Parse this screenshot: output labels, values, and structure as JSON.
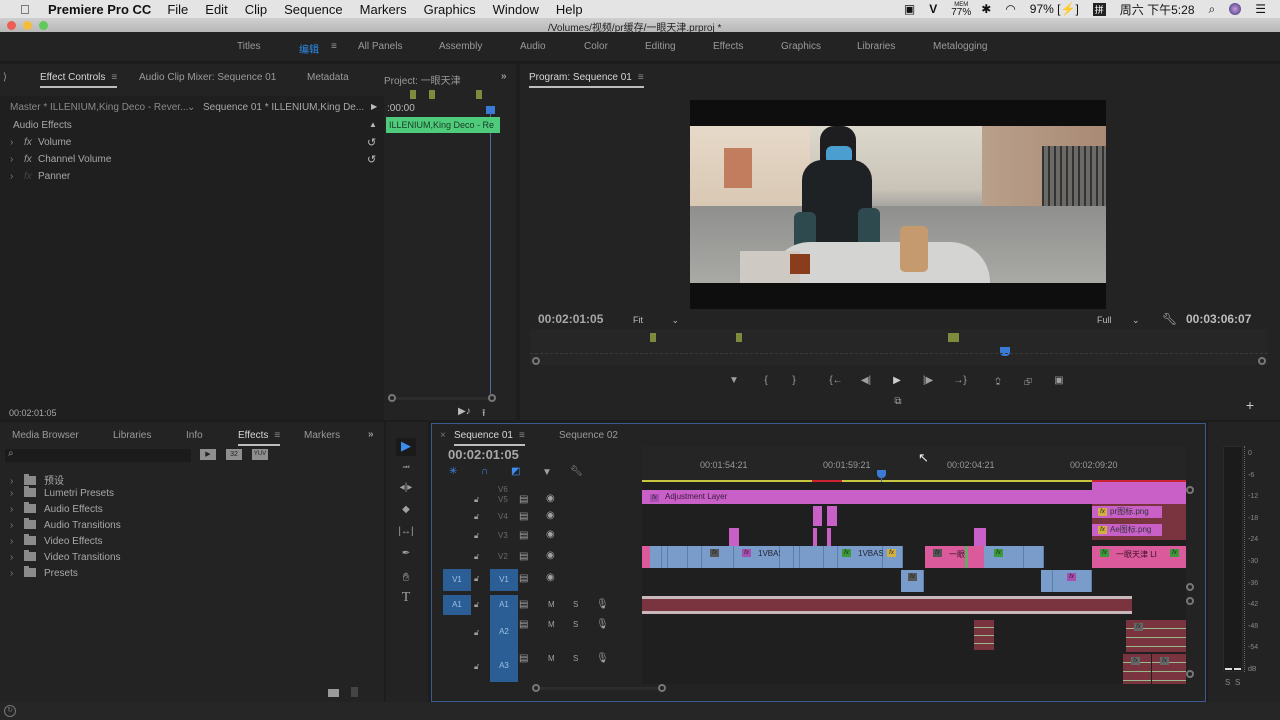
{
  "menubar": {
    "app_name": "Premiere Pro CC",
    "items": [
      "File",
      "Edit",
      "Clip",
      "Sequence",
      "Markers",
      "Graphics",
      "Window",
      "Help"
    ],
    "status": {
      "mem_label": "MEM",
      "mem_value": "77%",
      "battery": "97%",
      "clock": "周六 下午5:28"
    }
  },
  "window": {
    "title": "/Volumes/视频/pr缓存/一眼天津.prproj *"
  },
  "workspaces": {
    "items": [
      "Titles",
      "编辑",
      "All Panels",
      "Assembly",
      "Audio",
      "Color",
      "Editing",
      "Effects",
      "Graphics",
      "Libraries",
      "Metalogging"
    ],
    "active": "编辑"
  },
  "effect_controls": {
    "tabs": [
      "Effect Controls",
      "Audio Clip Mixer: Sequence 01",
      "Metadata",
      "Project: 一眼天津"
    ],
    "master_label": "Master * ILLENIUM,King Deco - Rever...",
    "sequence_label": "Sequence 01 * ILLENIUM,King De...",
    "section": "Audio Effects",
    "effects": [
      "Volume",
      "Channel Volume",
      "Panner"
    ],
    "mini_timecode": ":00:00",
    "mini_clip": "ILLENIUM,King Deco - Re",
    "footer_timecode": "00:02:01:05"
  },
  "program": {
    "title": "Program: Sequence 01",
    "timecode": "00:02:01:05",
    "fit": "Fit",
    "quality": "Full",
    "duration": "00:03:06:07"
  },
  "effects_panel": {
    "tabs": [
      "Media Browser",
      "Libraries",
      "Info",
      "Effects",
      "Markers"
    ],
    "active_tab": "Effects",
    "search_placeholder": "",
    "badges": [
      "32",
      "YUV"
    ],
    "folders": [
      "预设",
      "Lumetri Presets",
      "Audio Effects",
      "Audio Transitions",
      "Video Effects",
      "Video Transitions",
      "Presets"
    ]
  },
  "timeline": {
    "tabs": [
      "Sequence 01",
      "Sequence 02"
    ],
    "timecode": "00:02:01:05",
    "ruler": [
      "00:01:54:21",
      "00:01:59:21",
      "00:02:04:21",
      "00:02:09:20"
    ],
    "video_tracks": [
      "V6",
      "V5",
      "V4",
      "V3",
      "V2",
      "V1"
    ],
    "audio_tracks": [
      "A1",
      "A2",
      "A3"
    ],
    "source_v": "V1",
    "source_a": "A1",
    "mute": "M",
    "solo": "S",
    "clips": {
      "adjustment": "Adjustment Layer",
      "v2a": "1VBAS",
      "v2b": "1VBAS",
      "v2c": "一眼",
      "v2d": "一眼天津 LI",
      "v5r": "pr图标.png",
      "v4r": "Ae图标.png"
    }
  },
  "meter": {
    "scale": [
      "0",
      "-6",
      "-12",
      "-18",
      "-24",
      "-30",
      "-36",
      "-42",
      "-48",
      "-54",
      "dB"
    ],
    "solo": [
      "S",
      "S"
    ]
  }
}
